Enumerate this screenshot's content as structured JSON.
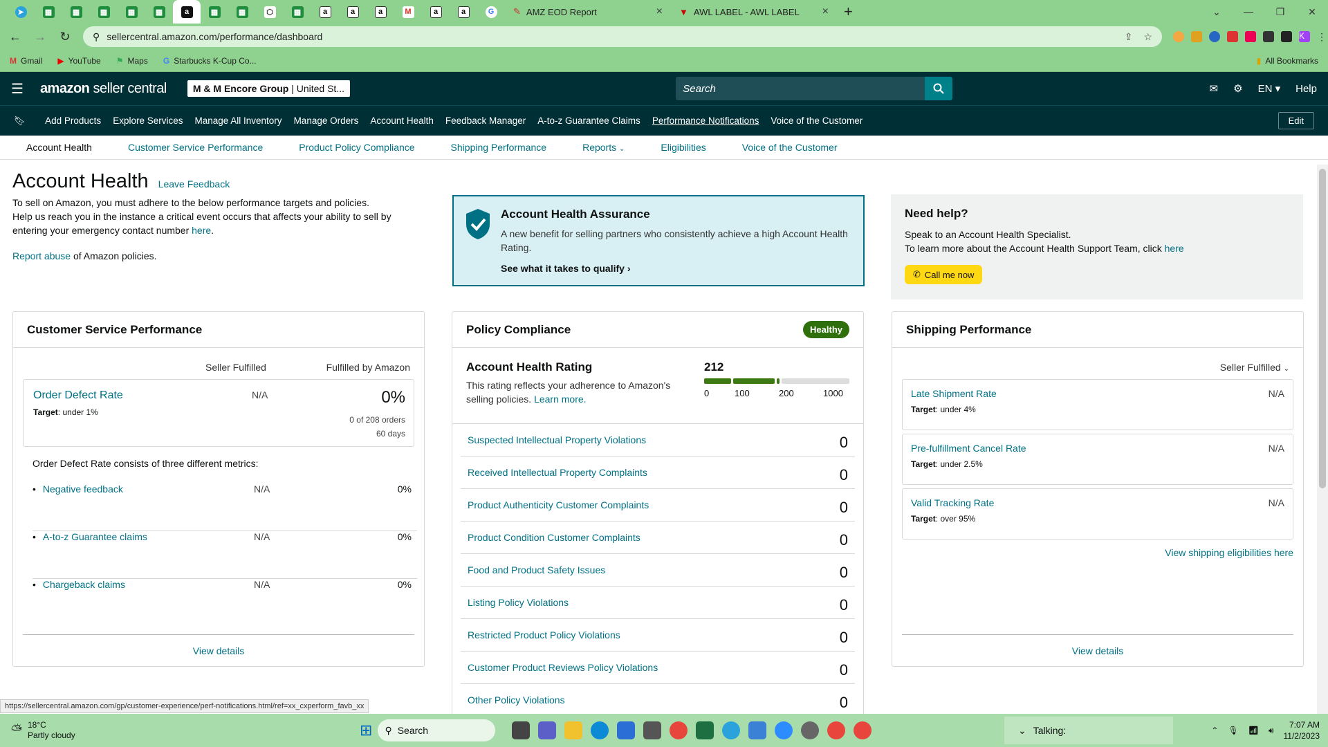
{
  "browser": {
    "tabs": [
      {
        "title": "AMZ EOD Report"
      },
      {
        "title": "AWL LABEL - AWL LABEL"
      }
    ],
    "url": "sellercentral.amazon.com/performance/dashboard",
    "bookmarks": [
      "Gmail",
      "YouTube",
      "Maps",
      "Starbucks K-Cup Co..."
    ],
    "all_bookmarks": "All Bookmarks",
    "profile_initial": "K"
  },
  "header": {
    "logo_brand": "amazon",
    "logo_product": "seller central",
    "store": "M & M Encore Group",
    "store_region": "| United St...",
    "search_placeholder": "Search",
    "lang": "EN",
    "help": "Help"
  },
  "nav": {
    "items": [
      "Add Products",
      "Explore Services",
      "Manage All Inventory",
      "Manage Orders",
      "Account Health",
      "Feedback Manager",
      "A-to-z Guarantee Claims",
      "Performance Notifications",
      "Voice of the Customer"
    ],
    "edit": "Edit"
  },
  "subnav": {
    "items": [
      "Account Health",
      "Customer Service Performance",
      "Product Policy Compliance",
      "Shipping Performance",
      "Reports",
      "Eligibilities",
      "Voice of the Customer"
    ]
  },
  "page": {
    "title": "Account Health",
    "leave_feedback": "Leave Feedback",
    "intro1": "To sell on Amazon, you must adhere to the below performance targets and policies.",
    "intro2": "Help us reach you in the instance a critical event occurs that affects your ability to sell by entering your emergency contact number",
    "intro_link": "here",
    "report_link": "Report abuse",
    "report_rest": "of Amazon policies."
  },
  "assurance": {
    "title": "Account Health Assurance",
    "text": "A new benefit for selling partners who consistently achieve a high Account Health Rating.",
    "cta": "See what it takes to qualify"
  },
  "help": {
    "title": "Need help?",
    "line1": "Speak to an Account Health Specialist.",
    "line2": "To learn more about the Account Health Support Team, click",
    "line2_link": "here",
    "button": "Call me now"
  },
  "csp": {
    "title": "Customer Service Performance",
    "col1": "Seller Fulfilled",
    "col2": "Fulfilled by Amazon",
    "odr_title": "Order Defect Rate",
    "odr_target_label": "Target",
    "odr_target": ": under 1%",
    "odr_sf": "N/A",
    "odr_fba": "0%",
    "odr_orders": "0 of 208 orders",
    "odr_days": "60 days",
    "consists": "Order Defect Rate consists of three different metrics:",
    "metrics": [
      {
        "name": "Negative feedback",
        "sf": "N/A",
        "fba": "0%"
      },
      {
        "name": "A-to-z Guarantee claims",
        "sf": "N/A",
        "fba": "0%"
      },
      {
        "name": "Chargeback claims",
        "sf": "N/A",
        "fba": "0%"
      }
    ],
    "view_details": "View details"
  },
  "policy": {
    "title": "Policy Compliance",
    "badge": "Healthy",
    "ahr_title": "Account Health Rating",
    "ahr_text": "This rating reflects your adherence to Amazon's selling policies.",
    "ahr_link": "Learn more.",
    "rating": "212",
    "rating_value": 212,
    "scale": [
      "0",
      "100",
      "200",
      "1000"
    ],
    "rows": [
      {
        "name": "Suspected Intellectual Property Violations",
        "value": "0"
      },
      {
        "name": "Received Intellectual Property Complaints",
        "value": "0"
      },
      {
        "name": "Product Authenticity Customer Complaints",
        "value": "0"
      },
      {
        "name": "Product Condition Customer Complaints",
        "value": "0"
      },
      {
        "name": "Food and Product Safety Issues",
        "value": "0"
      },
      {
        "name": "Listing Policy Violations",
        "value": "0"
      },
      {
        "name": "Restricted Product Policy Violations",
        "value": "0"
      },
      {
        "name": "Customer Product Reviews Policy Violations",
        "value": "0"
      },
      {
        "name": "Other Policy Violations",
        "value": "0"
      }
    ]
  },
  "shipping": {
    "title": "Shipping Performance",
    "dropdown": "Seller Fulfilled",
    "items": [
      {
        "name": "Late Shipment Rate",
        "target_label": "Target",
        "target": ": under 4%",
        "value": "N/A"
      },
      {
        "name": "Pre-fulfillment Cancel Rate",
        "target_label": "Target",
        "target": ": under 2.5%",
        "value": "N/A"
      },
      {
        "name": "Valid Tracking Rate",
        "target_label": "Target",
        "target": ": over 95%",
        "value": "N/A"
      }
    ],
    "eligibilities": "View shipping eligibilities here",
    "view_details": "View details"
  },
  "status_url": "https://sellercentral.amazon.com/gp/customer-experience/perf-notifications.html/ref=xx_cxperform_favb_xx",
  "taskbar": {
    "temp": "18°C",
    "weather": "Partly cloudy",
    "search": "Search",
    "talking": "Talking:",
    "time": "7:07 AM",
    "date": "11/2/2023"
  },
  "colors": {
    "teal": "#002f36",
    "link": "#007185",
    "healthy": "#2f6f0c",
    "assure_bg": "#d8f0f4"
  }
}
